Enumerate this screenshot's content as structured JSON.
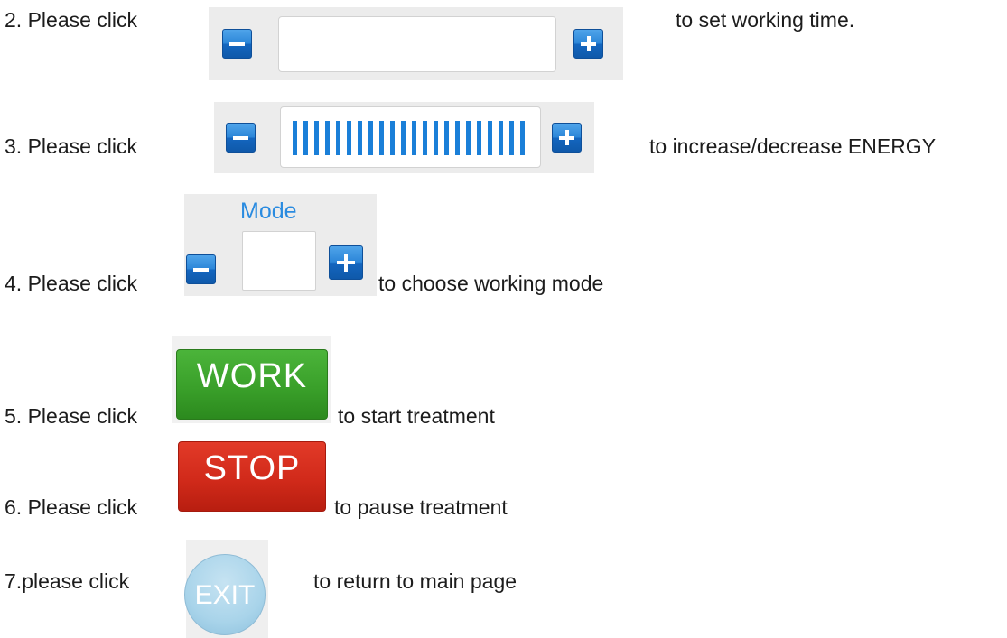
{
  "steps": [
    {
      "prefix": "2. Please click",
      "suffix": "to set working time."
    },
    {
      "prefix": "3. Please click",
      "suffix": "to increase/decrease ENERGY"
    },
    {
      "prefix": "4. Please click",
      "suffix": "to choose working mode"
    },
    {
      "prefix": "5. Please click",
      "suffix": "to start treatment"
    },
    {
      "prefix": "6. Please click",
      "suffix": "to pause treatment"
    },
    {
      "prefix": "7.please click",
      "suffix": "to return to main page"
    }
  ],
  "mode_label": "Mode",
  "energy_level": 1.0,
  "buttons": {
    "work": "WORK",
    "stop": "STOP",
    "exit": "EXIT"
  },
  "colors": {
    "accent": "#1a7fd8",
    "work": "#3a9e2a",
    "stop": "#d12a1a",
    "exit": "#a9d4ea"
  }
}
